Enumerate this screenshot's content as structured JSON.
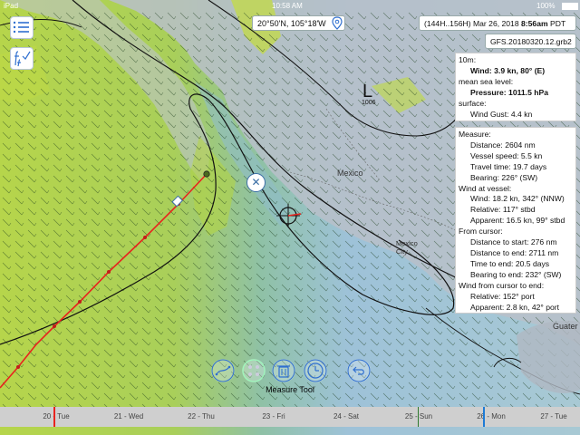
{
  "status_bar": {
    "carrier": "iPad",
    "time": "10:58 AM",
    "battery": "100%"
  },
  "coords": "20°50'N, 105°18'W",
  "time_range": "(144H..156H) Mar 26, 2018",
  "time_bold": "8:56am",
  "time_zone": "PDT",
  "file_name": "GFS.20180320.12.grb2",
  "map_labels": {
    "mexico": "Mexico",
    "mexico_city": "Mexico City",
    "guate": "Guater",
    "low_label": "L",
    "low_pressure": "1006"
  },
  "info_panel": {
    "level_10m": "10m:",
    "wind": "Wind: 3.9 kn, 80° (E)",
    "msl_title": "mean sea level:",
    "pressure": "Pressure: 1011.5 hPa",
    "surface_title": "surface:",
    "gust": "Wind Gust: 4.4 kn"
  },
  "measure_panel": {
    "title": "Measure:",
    "distance": "Distance: 2604 nm",
    "vessel_speed": "Vessel speed: 5.5 kn",
    "travel_time": "Travel time: 19.7 days",
    "bearing": "Bearing: 226° (SW)",
    "wind_at_vessel_title": "Wind at vessel:",
    "wind": "Wind: 18.2 kn, 342° (NNW)",
    "relative": "Relative: 117° stbd",
    "apparent": "Apparent: 16.5 kn, 99° stbd",
    "from_cursor_title": "From cursor:",
    "dist_start": "Distance to start: 276 nm",
    "dist_end": "Distance to end: 2711 nm",
    "time_end": "Time to end: 20.5 days",
    "bearing_end": "Bearing to end: 232° (SW)",
    "wind_cursor_title": "Wind from cursor to end:",
    "relative2": "Relative: 152° port",
    "apparent2": "Apparent: 2.8 kn, 42° port"
  },
  "toolbar": {
    "label": "Measure Tool"
  },
  "timeline": {
    "days": [
      "20 - Tue",
      "21 - Wed",
      "22 - Thu",
      "23 - Fri",
      "24 - Sat",
      "25 - Sun",
      "26 - Mon",
      "27 - Tue"
    ]
  },
  "colors": {
    "sea_green": "#b8d64a",
    "sea_blue": "#9fc3d6",
    "land_gray": "#b4bcc6",
    "route_red": "#e8231e",
    "timeline_blue": "#1e7bd6"
  }
}
